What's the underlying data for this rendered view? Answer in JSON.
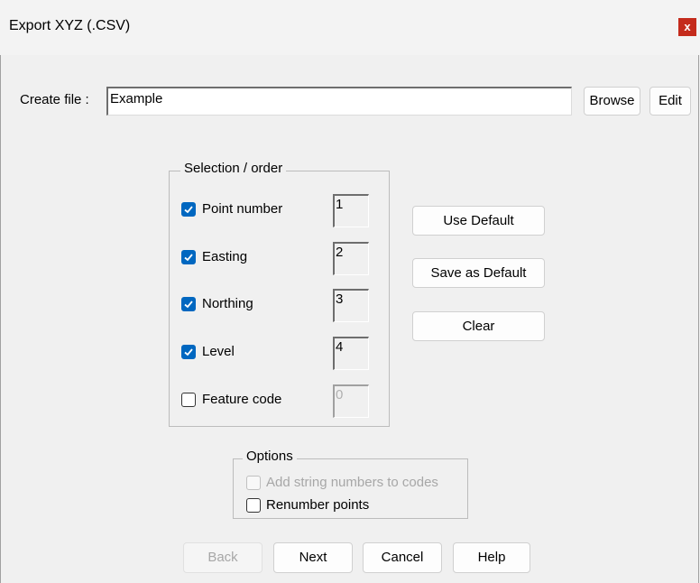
{
  "window": {
    "title": "Export XYZ (.CSV)",
    "close_glyph": "x"
  },
  "file": {
    "label": "Create file :",
    "value": "Example",
    "browse_label": "Browse",
    "edit_label": "Edit"
  },
  "selection": {
    "legend": "Selection / order",
    "items": [
      {
        "label": "Point number",
        "checked": true,
        "order": "1"
      },
      {
        "label": "Easting",
        "checked": true,
        "order": "2"
      },
      {
        "label": "Northing",
        "checked": true,
        "order": "3"
      },
      {
        "label": "Level",
        "checked": true,
        "order": "4"
      },
      {
        "label": "Feature code",
        "checked": false,
        "order": "0"
      }
    ]
  },
  "side_buttons": {
    "use_default": "Use Default",
    "save_default": "Save as Default",
    "clear": "Clear"
  },
  "options": {
    "legend": "Options",
    "add_string": {
      "label": "Add string numbers to codes",
      "checked": false,
      "enabled": false
    },
    "renumber": {
      "label": "Renumber points",
      "checked": false,
      "enabled": true
    }
  },
  "footer": {
    "back": "Back",
    "next": "Next",
    "cancel": "Cancel",
    "help": "Help"
  },
  "colors": {
    "accent": "#0067c0",
    "close": "#c42b1c"
  }
}
